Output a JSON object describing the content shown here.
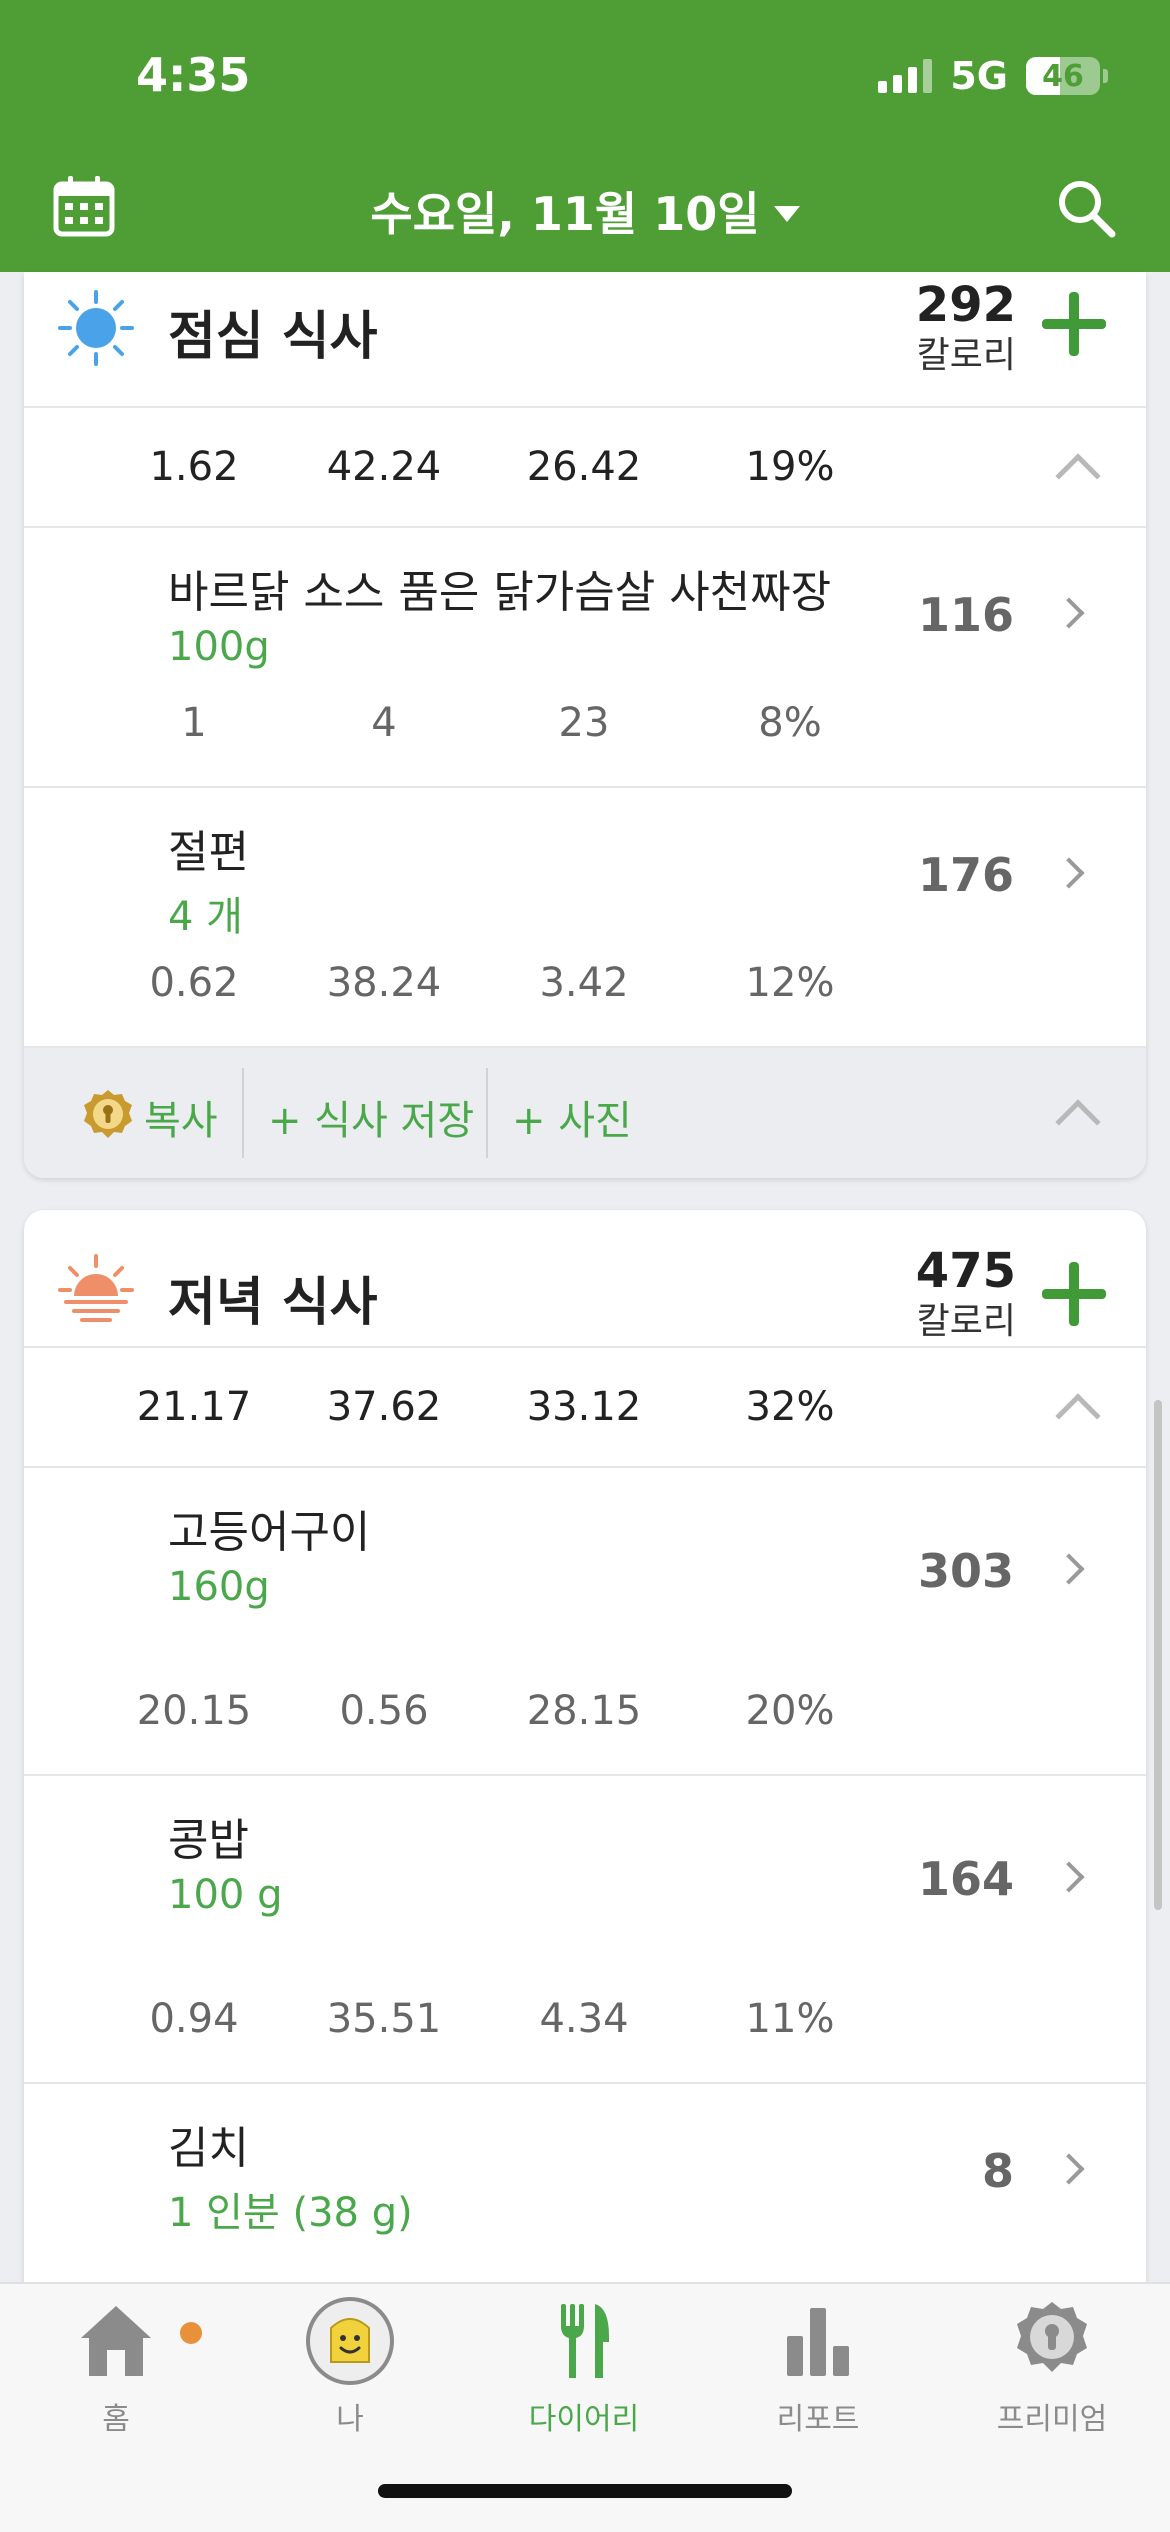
{
  "status_bar": {
    "time": "4:35",
    "network": "5G",
    "battery": "46"
  },
  "header": {
    "date": "수요일, 11월 10일"
  },
  "lunch": {
    "title": "점심 식사",
    "calories": "292",
    "calories_unit": "칼로리",
    "summary": [
      "1.62",
      "42.24",
      "26.42",
      "19%"
    ],
    "items": [
      {
        "name": "바르닭 소스 품은 닭가슴살 사천짜장",
        "qty": "100g",
        "cal": "116",
        "macros": [
          "1",
          "4",
          "23",
          "8%"
        ]
      },
      {
        "name": "절편",
        "qty": "4 개",
        "cal": "176",
        "macros": [
          "0.62",
          "38.24",
          "3.42",
          "12%"
        ]
      }
    ],
    "actions": {
      "copy": "복사",
      "save_meal": "+ 식사 저장",
      "photo": "+ 사진"
    }
  },
  "dinner": {
    "title": "저녁 식사",
    "calories": "475",
    "calories_unit": "칼로리",
    "summary": [
      "21.17",
      "37.62",
      "33.12",
      "32%"
    ],
    "items": [
      {
        "name": "고등어구이",
        "qty": "160g",
        "cal": "303",
        "macros": [
          "20.15",
          "0.56",
          "28.15",
          "20%"
        ]
      },
      {
        "name": "콩밥",
        "qty": "100 g",
        "cal": "164",
        "macros": [
          "0.94",
          "35.51",
          "4.34",
          "11%"
        ]
      },
      {
        "name": "김치",
        "qty": "1 인분 (38 g)",
        "cal": "8"
      }
    ]
  },
  "tabbar": {
    "tabs": [
      {
        "label": "홈",
        "icon": "home-icon"
      },
      {
        "label": "나",
        "icon": "avatar-icon"
      },
      {
        "label": "다이어리",
        "icon": "fork-knife-icon",
        "active": true
      },
      {
        "label": "리포트",
        "icon": "bar-chart-icon"
      },
      {
        "label": "프리미엄",
        "icon": "premium-badge-icon"
      }
    ]
  },
  "colors": {
    "header": "#4e9e35",
    "accent_green": "#4aa84a",
    "badge_dot": "#e8913a"
  }
}
